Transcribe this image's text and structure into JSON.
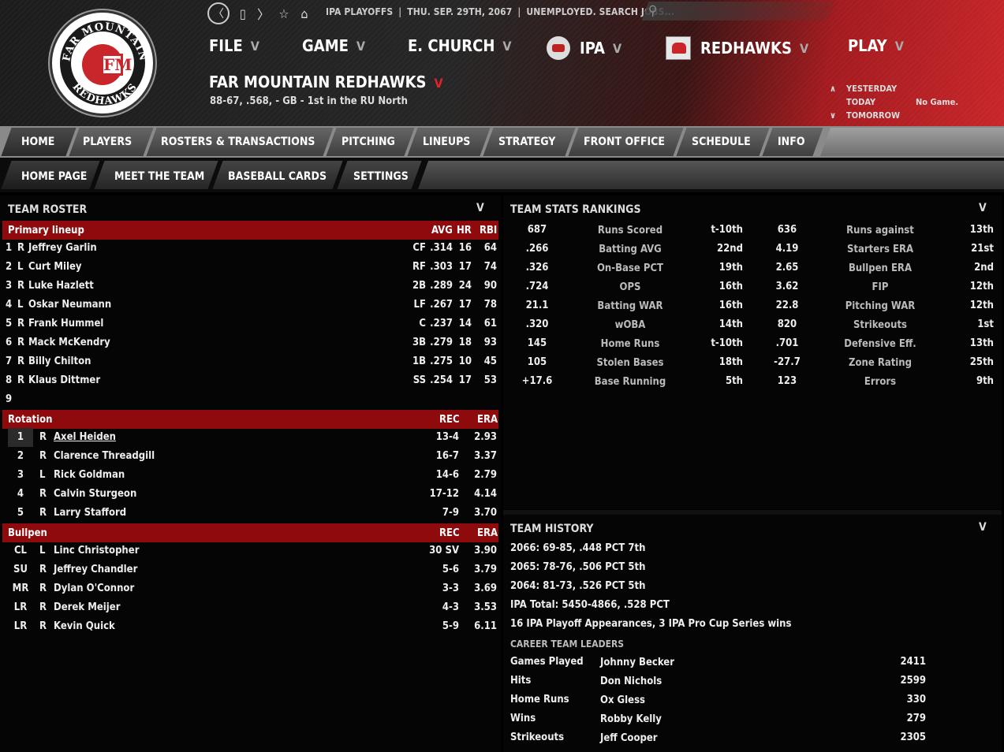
{
  "header": {
    "top_nav": {
      "back": "〈",
      "page": "▯",
      "forward": "〉",
      "star": "☆",
      "home": "⌂"
    },
    "league_status": "IPA PLAYOFFS",
    "date": "THU. SEP. 29TH, 2067",
    "job_status": "UNEMPLOYED. SEARCH JOBS...",
    "search_placeholder": "",
    "menu": {
      "file": "FILE",
      "game": "GAME",
      "manager": "E. CHURCH",
      "league": "IPA",
      "team": "REDHAWKS",
      "play": "PLAY"
    },
    "team_name": "FAR MOUNTAIN REDHAWKS",
    "team_record": "88-67, .568, - GB - 1st in the RU North",
    "day_nav": {
      "yesterday": "YESTERDAY",
      "today": "TODAY",
      "tomorrow": "TOMORROW",
      "today_game": "No Game."
    },
    "accent_color": "#c8262a"
  },
  "tabs_primary": [
    "HOME",
    "PLAYERS",
    "ROSTERS & TRANSACTIONS",
    "PITCHING",
    "LINEUPS",
    "STRATEGY",
    "FRONT OFFICE",
    "SCHEDULE",
    "INFO"
  ],
  "tabs_secondary": [
    "HOME PAGE",
    "MEET THE TEAM",
    "BASEBALL CARDS",
    "SETTINGS"
  ],
  "roster": {
    "title": "TEAM ROSTER",
    "lineup_header": {
      "label": "Primary lineup",
      "avg": "AVG",
      "hr": "HR",
      "rbi": "RBI"
    },
    "lineup": [
      {
        "n": "1",
        "hand": "R",
        "name": "Jeffrey Garlin",
        "pos": "CF",
        "avg": ".314",
        "hr": "16",
        "rbi": "64"
      },
      {
        "n": "2",
        "hand": "L",
        "name": "Curt Miley",
        "pos": "RF",
        "avg": ".303",
        "hr": "17",
        "rbi": "74"
      },
      {
        "n": "3",
        "hand": "R",
        "name": "Luke Hazlett",
        "pos": "2B",
        "avg": ".289",
        "hr": "24",
        "rbi": "90"
      },
      {
        "n": "4",
        "hand": "L",
        "name": "Oskar Neumann",
        "pos": "LF",
        "avg": ".267",
        "hr": "17",
        "rbi": "78"
      },
      {
        "n": "5",
        "hand": "R",
        "name": "Frank Hummel",
        "pos": "C",
        "avg": ".237",
        "hr": "14",
        "rbi": "61"
      },
      {
        "n": "6",
        "hand": "R",
        "name": "Mack McKendry",
        "pos": "3B",
        "avg": ".279",
        "hr": "18",
        "rbi": "93"
      },
      {
        "n": "7",
        "hand": "R",
        "name": "Billy Chilton",
        "pos": "1B",
        "avg": ".275",
        "hr": "10",
        "rbi": "45"
      },
      {
        "n": "8",
        "hand": "R",
        "name": "Klaus Dittmer",
        "pos": "SS",
        "avg": ".254",
        "hr": "17",
        "rbi": "53"
      },
      {
        "n": "9",
        "hand": "",
        "name": "",
        "pos": "",
        "avg": "",
        "hr": "",
        "rbi": ""
      }
    ],
    "rotation_header": {
      "label": "Rotation",
      "rec": "REC",
      "era": "ERA"
    },
    "rotation": [
      {
        "n": "1",
        "hand": "R",
        "name": "Axel Heiden",
        "rec": "13-4",
        "era": "2.93"
      },
      {
        "n": "2",
        "hand": "R",
        "name": "Clarence Threadgill",
        "rec": "16-7",
        "era": "3.37"
      },
      {
        "n": "3",
        "hand": "L",
        "name": "Rick Goldman",
        "rec": "14-6",
        "era": "2.79"
      },
      {
        "n": "4",
        "hand": "R",
        "name": "Calvin Sturgeon",
        "rec": "17-12",
        "era": "4.14"
      },
      {
        "n": "5",
        "hand": "R",
        "name": "Larry Stafford",
        "rec": "7-9",
        "era": "3.70"
      }
    ],
    "bullpen_header": {
      "label": "Bullpen",
      "rec": "REC",
      "era": "ERA"
    },
    "bullpen": [
      {
        "role": "CL",
        "hand": "L",
        "name": "Linc Christopher",
        "rec": "30 SV",
        "era": "3.90"
      },
      {
        "role": "SU",
        "hand": "R",
        "name": "Jeffrey Chandler",
        "rec": "5-6",
        "era": "3.79"
      },
      {
        "role": "MR",
        "hand": "R",
        "name": "Dylan O'Connor",
        "rec": "3-3",
        "era": "3.69"
      },
      {
        "role": "LR",
        "hand": "R",
        "name": "Derek Meijer",
        "rec": "4-3",
        "era": "3.53"
      },
      {
        "role": "LR",
        "hand": "R",
        "name": "Kevin Quick",
        "rec": "5-9",
        "era": "6.11"
      }
    ]
  },
  "rankings": {
    "title": "TEAM STATS RANKINGS",
    "rows": [
      {
        "v1": "687",
        "l1": "Runs Scored",
        "r1": "t-10th",
        "v2": "636",
        "l2": "Runs against",
        "r2": "13th"
      },
      {
        "v1": ".266",
        "l1": "Batting AVG",
        "r1": "22nd",
        "v2": "4.19",
        "l2": "Starters ERA",
        "r2": "21st"
      },
      {
        "v1": ".326",
        "l1": "On-Base PCT",
        "r1": "19th",
        "v2": "2.65",
        "l2": "Bullpen ERA",
        "r2": "2nd"
      },
      {
        "v1": ".724",
        "l1": "OPS",
        "r1": "16th",
        "v2": "3.62",
        "l2": "FIP",
        "r2": "12th"
      },
      {
        "v1": "21.1",
        "l1": "Batting WAR",
        "r1": "16th",
        "v2": "22.8",
        "l2": "Pitching WAR",
        "r2": "12th"
      },
      {
        "v1": ".320",
        "l1": "wOBA",
        "r1": "14th",
        "v2": "820",
        "l2": "Strikeouts",
        "r2": "1st"
      },
      {
        "v1": "145",
        "l1": "Home Runs",
        "r1": "t-10th",
        "v2": ".701",
        "l2": "Defensive Eff.",
        "r2": "13th"
      },
      {
        "v1": "105",
        "l1": "Stolen Bases",
        "r1": "18th",
        "v2": "-27.7",
        "l2": "Zone Rating",
        "r2": "25th"
      },
      {
        "v1": "+17.6",
        "l1": "Base Running",
        "r1": "5th",
        "v2": "123",
        "l2": "Errors",
        "r2": "9th"
      }
    ]
  },
  "history": {
    "title": "TEAM HISTORY",
    "lines": [
      "2066: 69-85, .448 PCT 7th",
      "2065: 78-76, .506 PCT 5th",
      "2064: 81-73, .526 PCT 5th",
      "IPA Total: 5450-4866, .528 PCT",
      "16 IPA Playoff Appearances, 3 IPA Pro Cup Series wins"
    ],
    "leaders_title": "CAREER TEAM LEADERS",
    "leaders": [
      {
        "stat": "Games Played",
        "name": "Johnny Becker",
        "value": "2411"
      },
      {
        "stat": "Hits",
        "name": "Don Nichols",
        "value": "2599"
      },
      {
        "stat": "Home Runs",
        "name": "Ox Gless",
        "value": "330"
      },
      {
        "stat": "Wins",
        "name": "Robby Kelly",
        "value": "279"
      },
      {
        "stat": "Strikeouts",
        "name": "Jeff Cooper",
        "value": "2305"
      }
    ]
  },
  "logo": {
    "ring_top": "FAR MOUNTAIN",
    "ring_bottom": "REDHAWKS",
    "monogram": "FM"
  }
}
